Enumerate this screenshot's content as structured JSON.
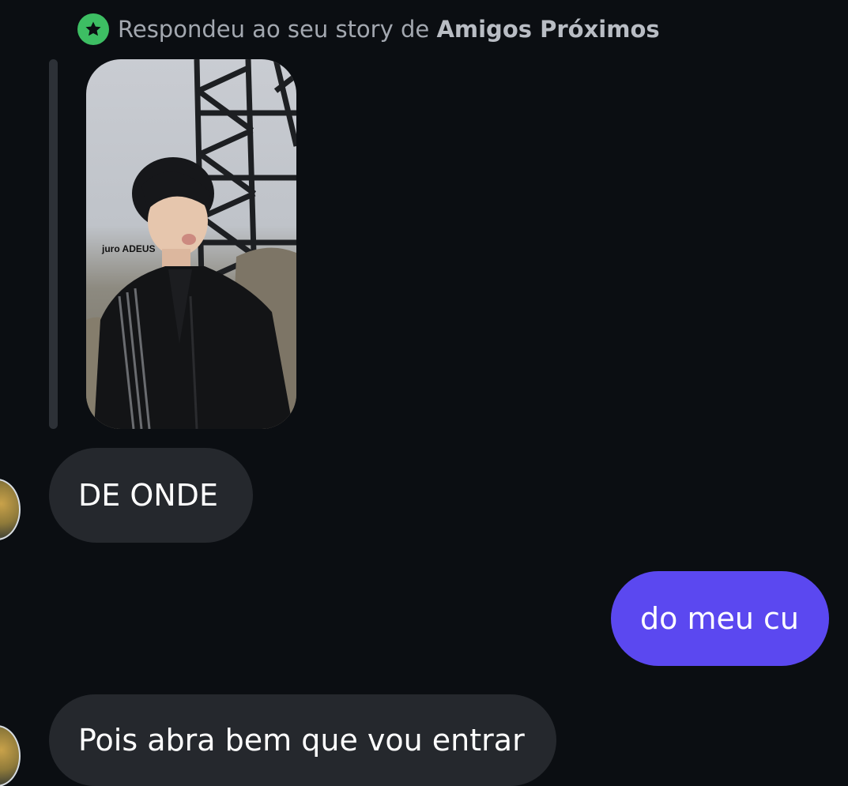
{
  "reply_header": {
    "prefix": "Respondeu ao seu story de",
    "audience": "Amigos Próximos",
    "badge_color": "#3dbe63",
    "badge_icon": "star-icon"
  },
  "story": {
    "caption": "juro ADEUS"
  },
  "colors": {
    "background": "#0b0e12",
    "incoming_bubble": "#25282d",
    "outgoing_bubble": "#5b48f0"
  },
  "messages": [
    {
      "direction": "incoming",
      "text": "DE ONDE"
    },
    {
      "direction": "outgoing",
      "text": "do meu cu"
    },
    {
      "direction": "incoming",
      "text": "Pois abra bem que vou entrar"
    }
  ]
}
